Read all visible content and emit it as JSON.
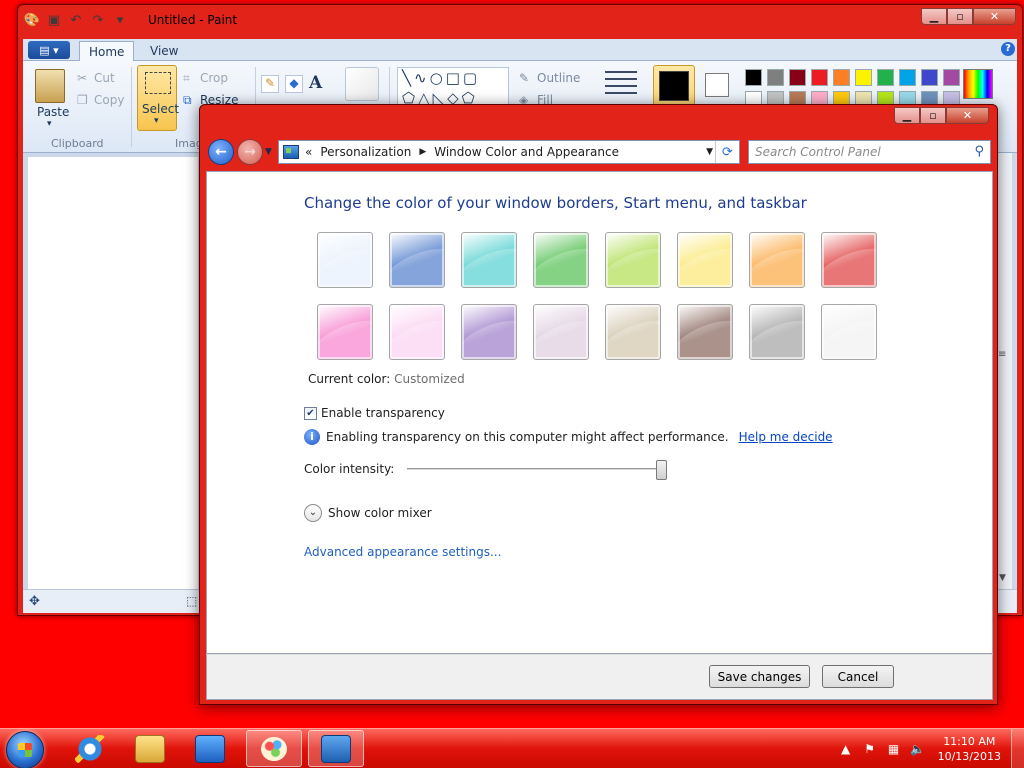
{
  "paint": {
    "title": "Untitled - Paint",
    "tabs": [
      "Home",
      "View"
    ],
    "clipboard": {
      "paste": "Paste",
      "cut": "Cut",
      "copy": "Copy",
      "group": "Clipboard"
    },
    "image": {
      "select": "Select",
      "crop": "Crop",
      "resize": "Resize",
      "group": "Imag"
    },
    "shapes": {
      "outline": "Outline",
      "fill": "Fill"
    },
    "palette_row1": [
      "#000000",
      "#7f7f7f",
      "#880015",
      "#ed1c24",
      "#ff7f27",
      "#fff200",
      "#22b14c",
      "#00a2e8",
      "#3f48cc",
      "#a349a4"
    ],
    "palette_row2": [
      "#ffffff",
      "#c3c3c3",
      "#b97a57",
      "#ffaec9",
      "#ffc90e",
      "#efe4b0",
      "#b5e61d",
      "#99d9ea",
      "#7092be",
      "#c8bfe7"
    ]
  },
  "cp": {
    "breadcrumb": [
      "Personalization",
      "Window Color and Appearance"
    ],
    "search_placeholder": "Search Control Panel",
    "heading": "Change the color of your window borders, Start menu, and taskbar",
    "tiles_row1": [
      "#e8f1fc",
      "#5b86cf",
      "#5fd3d3",
      "#5cc35c",
      "#b4e05c",
      "#fbe97c",
      "#fbae4e",
      "#e04848"
    ],
    "tiles_row2": [
      "#f78ad0",
      "#fbd4f2",
      "#a385cc",
      "#e0d0e0",
      "#d4c8b0",
      "#8f6f66",
      "#a8a8a8",
      "#f2f2f2"
    ],
    "current_label": "Current color:",
    "current_value": "Customized",
    "transparency_label": "Enable transparency",
    "transparency_checked": true,
    "info_text": "Enabling transparency on this computer might affect performance.",
    "help_link": "Help me decide",
    "intensity_label": "Color intensity:",
    "intensity_value": 100,
    "mixer_label": "Show color mixer",
    "advanced_link": "Advanced appearance settings...",
    "save_button": "Save changes",
    "cancel_button": "Cancel"
  },
  "taskbar": {
    "time": "11:10 AM",
    "date": "10/13/2013"
  }
}
